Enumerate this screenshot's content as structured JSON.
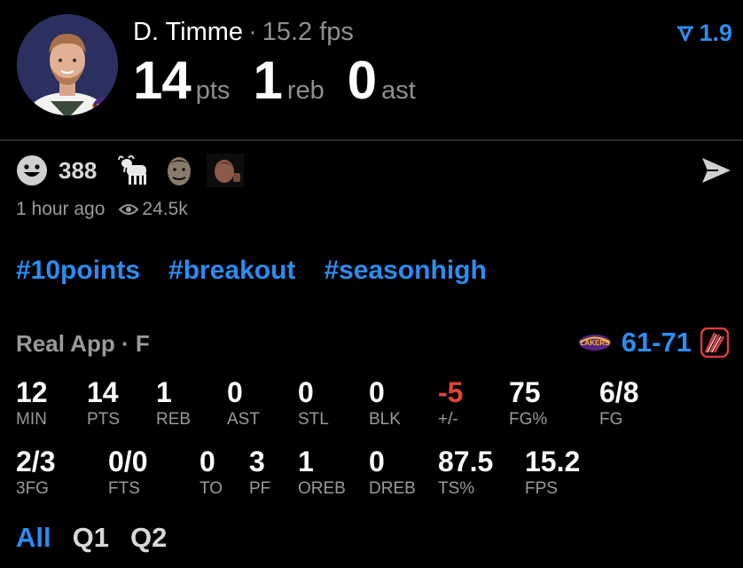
{
  "player": {
    "name": "D. Timme",
    "separator": "·",
    "fps_label": "15.2 fps",
    "pts": "14",
    "pts_unit": "pts",
    "reb": "1",
    "reb_unit": "reb",
    "ast": "0",
    "ast_unit": "ast",
    "team_logo_text": "LAKERS"
  },
  "trend": {
    "value": "1.9",
    "icon": "trend-down-icon",
    "color": "#2d8cf0"
  },
  "reactions": {
    "count": "388",
    "icons": [
      "smiley-icon",
      "goat-icon",
      "face-sticker-icon",
      "face-sticker-2-icon"
    ]
  },
  "meta": {
    "time": "1 hour ago",
    "views": "24.5k"
  },
  "tags": [
    "#10points",
    "#breakout",
    "#seasonhigh"
  ],
  "game": {
    "league": "Real App · F",
    "score": "61-71",
    "home_logo_text": "LAKERS",
    "away_logo": "trail-blazers-logo"
  },
  "stats_row1": [
    {
      "value": "12",
      "label": "MIN"
    },
    {
      "value": "14",
      "label": "PTS"
    },
    {
      "value": "1",
      "label": "REB"
    },
    {
      "value": "0",
      "label": "AST"
    },
    {
      "value": "0",
      "label": "STL"
    },
    {
      "value": "0",
      "label": "BLK"
    },
    {
      "value": "-5",
      "label": "+/-"
    },
    {
      "value": "75",
      "label": "FG%"
    },
    {
      "value": "6/8",
      "label": "FG"
    }
  ],
  "stats_row2": [
    {
      "value": "2/3",
      "label": "3FG"
    },
    {
      "value": "0/0",
      "label": "FTS"
    },
    {
      "value": "0",
      "label": "TO"
    },
    {
      "value": "3",
      "label": "PF"
    },
    {
      "value": "1",
      "label": "OREB"
    },
    {
      "value": "0",
      "label": "DREB"
    },
    {
      "value": "87.5",
      "label": "TS%"
    },
    {
      "value": "15.2",
      "label": "FPS"
    }
  ],
  "quarters": [
    "All",
    "Q1",
    "Q2"
  ],
  "colors": {
    "accent": "#2d8cf0",
    "negative": "#e0443a",
    "muted": "#9a9a9a"
  }
}
